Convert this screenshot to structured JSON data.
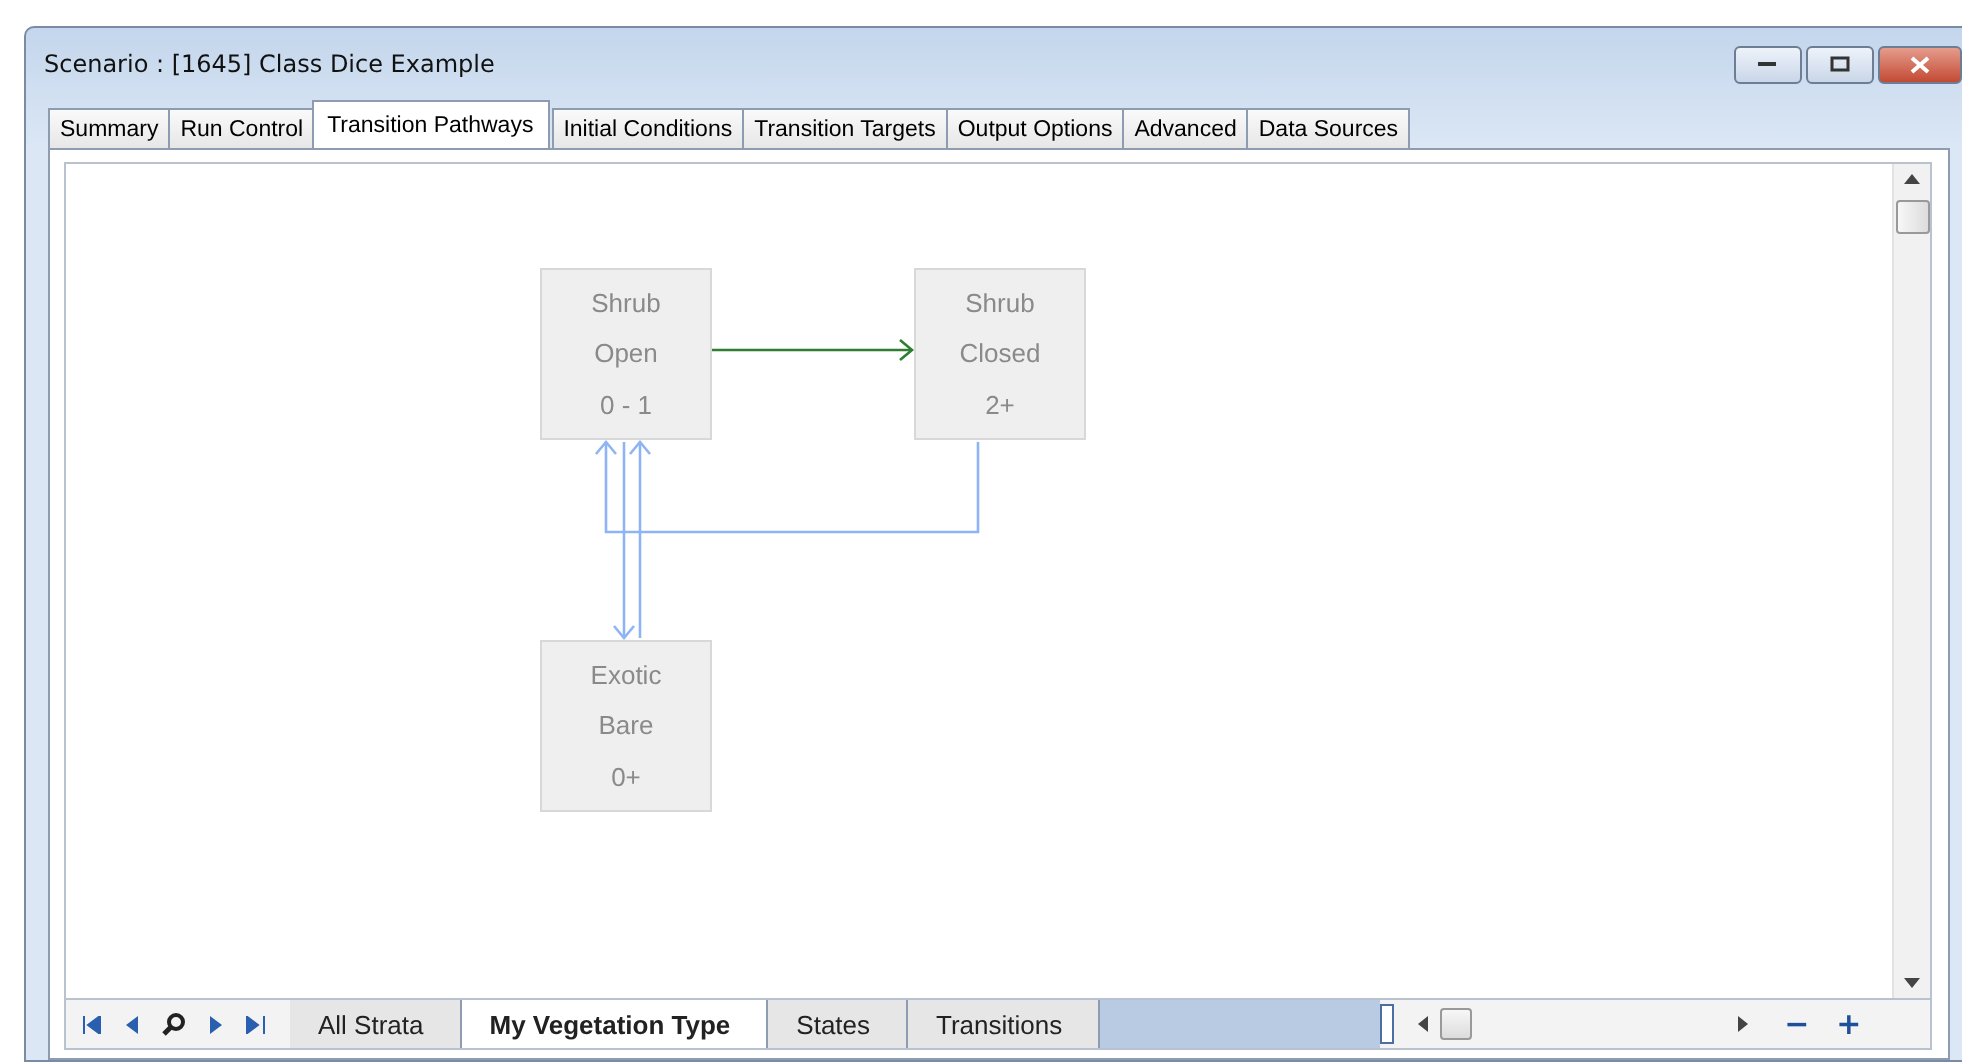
{
  "window": {
    "title": "Scenario : [1645] Class Dice Example"
  },
  "tabs": [
    {
      "label": "Summary",
      "selected": false
    },
    {
      "label": "Run Control",
      "selected": false
    },
    {
      "label": "Transition Pathways",
      "selected": true
    },
    {
      "label": "Initial Conditions",
      "selected": false
    },
    {
      "label": "Transition Targets",
      "selected": false
    },
    {
      "label": "Output Options",
      "selected": false
    },
    {
      "label": "Advanced",
      "selected": false
    },
    {
      "label": "Data Sources",
      "selected": false
    }
  ],
  "diagram": {
    "states": [
      {
        "lines": [
          "Shrub",
          "Open",
          "0 - 1"
        ]
      },
      {
        "lines": [
          "Shrub",
          "Closed",
          "2+"
        ]
      },
      {
        "lines": [
          "Exotic",
          "Bare",
          "0+"
        ]
      }
    ],
    "transitions": [
      {
        "kind": "deterministic"
      },
      {
        "kind": "probabilistic"
      },
      {
        "kind": "probabilistic"
      },
      {
        "kind": "probabilistic"
      }
    ]
  },
  "bottom_tabs": [
    {
      "label": "All Strata",
      "selected": false
    },
    {
      "label": "My Vegetation Type",
      "selected": true
    },
    {
      "label": "States",
      "selected": false
    },
    {
      "label": "Transitions",
      "selected": false
    }
  ],
  "zoom_buttons": [
    "−",
    "+"
  ]
}
